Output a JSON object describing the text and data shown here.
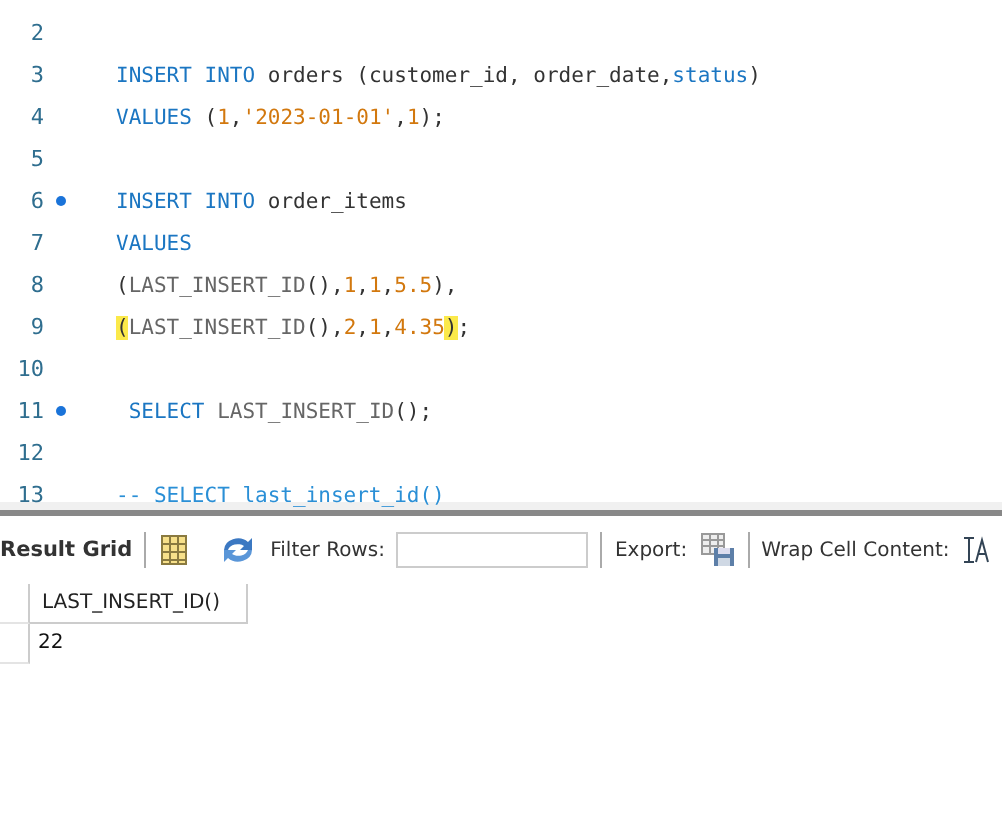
{
  "editor": {
    "lines": [
      {
        "number": "2",
        "bookmark": false
      },
      {
        "number": "3",
        "bookmark": false,
        "tokens": [
          {
            "kind": "keyword",
            "text": "INSERT INTO"
          },
          {
            "kind": "plain",
            "text": " orders (customer_id, order_date,"
          },
          {
            "kind": "keyword",
            "text": "status"
          },
          {
            "kind": "plain",
            "text": ")"
          }
        ]
      },
      {
        "number": "4",
        "bookmark": false,
        "tokens": [
          {
            "kind": "keyword",
            "text": "VALUES"
          },
          {
            "kind": "plain",
            "text": " ("
          },
          {
            "kind": "number",
            "text": "1"
          },
          {
            "kind": "plain",
            "text": ","
          },
          {
            "kind": "number",
            "text": "'2023-01-01'"
          },
          {
            "kind": "plain",
            "text": ","
          },
          {
            "kind": "number",
            "text": "1"
          },
          {
            "kind": "plain",
            "text": ");"
          }
        ]
      },
      {
        "number": "5",
        "bookmark": false
      },
      {
        "number": "6",
        "bookmark": true,
        "tokens": [
          {
            "kind": "keyword",
            "text": "INSERT INTO"
          },
          {
            "kind": "plain",
            "text": " order_items"
          }
        ]
      },
      {
        "number": "7",
        "bookmark": false,
        "tokens": [
          {
            "kind": "keyword",
            "text": "VALUES"
          }
        ]
      },
      {
        "number": "8",
        "bookmark": false,
        "tokens": [
          {
            "kind": "plain",
            "text": "("
          },
          {
            "kind": "function",
            "text": "LAST_INSERT_ID"
          },
          {
            "kind": "plain",
            "text": "(),"
          },
          {
            "kind": "number",
            "text": "1"
          },
          {
            "kind": "plain",
            "text": ","
          },
          {
            "kind": "number",
            "text": "1"
          },
          {
            "kind": "plain",
            "text": ","
          },
          {
            "kind": "number",
            "text": "5.5"
          },
          {
            "kind": "plain",
            "text": "),"
          }
        ]
      },
      {
        "number": "9",
        "bookmark": false,
        "tokens": [
          {
            "kind": "match",
            "text": "("
          },
          {
            "kind": "function",
            "text": "LAST_INSERT_ID"
          },
          {
            "kind": "plain",
            "text": "(),"
          },
          {
            "kind": "number",
            "text": "2"
          },
          {
            "kind": "plain",
            "text": ","
          },
          {
            "kind": "number",
            "text": "1"
          },
          {
            "kind": "plain",
            "text": ","
          },
          {
            "kind": "number",
            "text": "4.35"
          },
          {
            "kind": "match",
            "text": ")"
          },
          {
            "kind": "plain",
            "text": ";"
          }
        ]
      },
      {
        "number": "10",
        "bookmark": false
      },
      {
        "number": "11",
        "bookmark": true,
        "tokens": [
          {
            "kind": "keyword",
            "text": " SELECT"
          },
          {
            "kind": "function",
            "text": " LAST_INSERT_ID"
          },
          {
            "kind": "plain",
            "text": "();"
          }
        ]
      },
      {
        "number": "12",
        "bookmark": false
      },
      {
        "number": "13",
        "bookmark": false,
        "tokens": [
          {
            "kind": "comment",
            "text": "-- SELECT last_insert_id()"
          }
        ]
      }
    ]
  },
  "toolbar": {
    "result_label": "Result Grid",
    "filter_label": "Filter Rows:",
    "export_label": "Export:",
    "wrap_label": "Wrap Cell Content:"
  },
  "grid": {
    "columns": [
      "LAST_INSERT_ID()"
    ],
    "rows": [
      [
        "22"
      ]
    ]
  }
}
